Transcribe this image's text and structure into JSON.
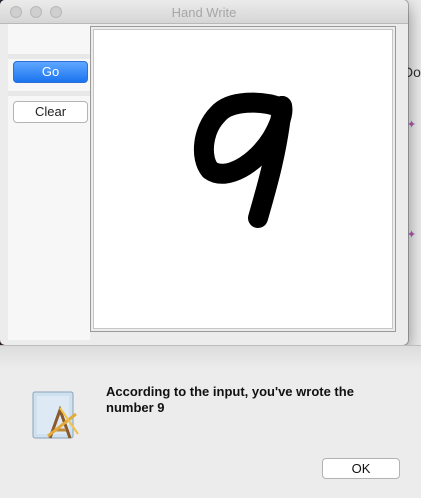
{
  "window": {
    "title": "Hand Write",
    "go_label": "Go",
    "clear_label": "Clear"
  },
  "background_window": {
    "text_fragment": "Do"
  },
  "dialog": {
    "message": "According to the input, you've wrote the number 9",
    "ok_label": "OK",
    "icon": "app-installer-icon"
  },
  "colors": {
    "accent": "#1b74f0",
    "ink": "#000000"
  }
}
